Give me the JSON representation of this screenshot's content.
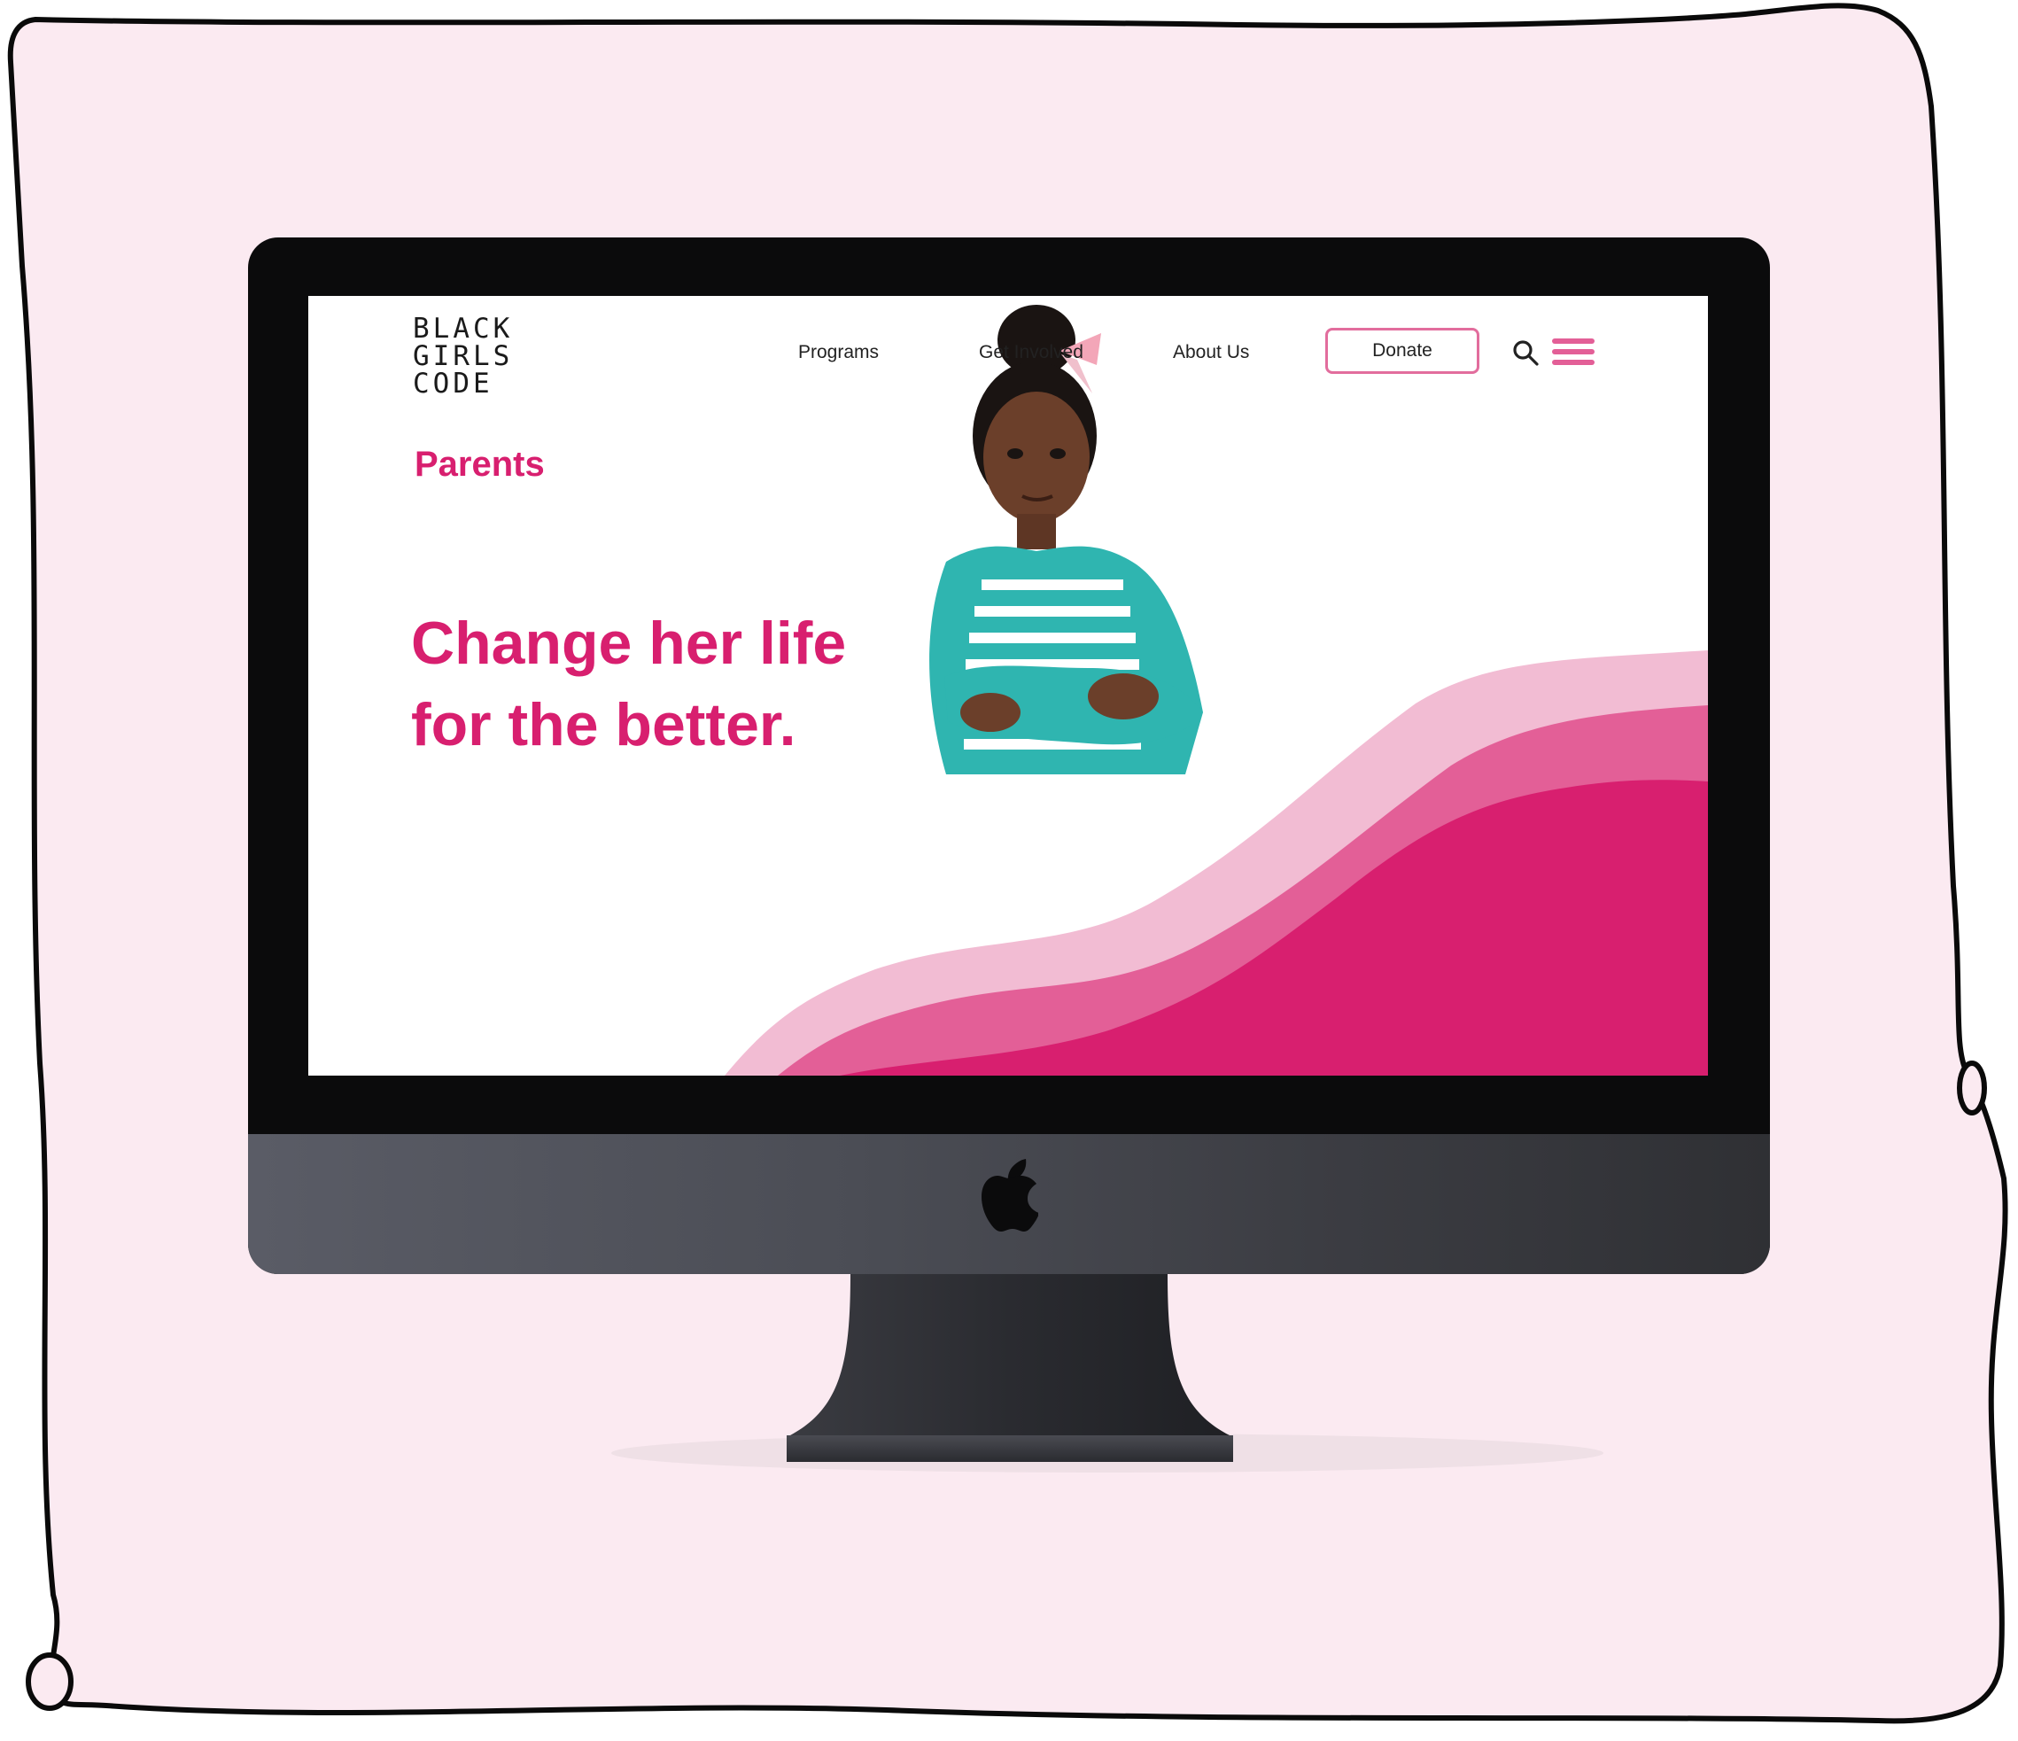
{
  "site": {
    "logo_lines": [
      "BLACK",
      "GIRLS",
      "CODE"
    ],
    "nav": {
      "programs": "Programs",
      "get_involved": "Get Involved",
      "about_us": "About Us",
      "donate": "Donate"
    },
    "section_label": "Parents",
    "headline_lines": [
      "Change her life",
      "for the better."
    ]
  },
  "icons": {
    "search": "search-icon",
    "menu": "hamburger-menu-icon",
    "brand": "apple-logo-icon"
  },
  "colors": {
    "accent": "#d81f6f",
    "wave_light": "#f2bcd3",
    "wave_mid": "#e35f97",
    "wave_dark": "#d81f6f",
    "backdrop": "#fbeaf1"
  }
}
